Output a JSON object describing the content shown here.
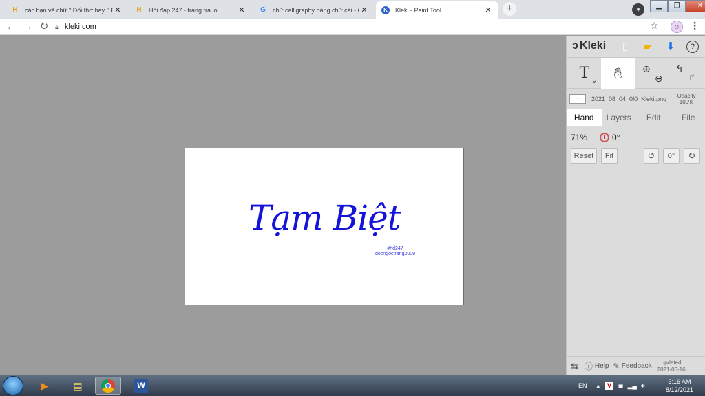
{
  "browser": {
    "tabs": [
      {
        "title": "các bạn vẽ chữ \" Đối thơ hay \" Bằ",
        "favicon": "H"
      },
      {
        "title": "Hỏi đáp 247 - trang tra loi",
        "favicon": "H"
      },
      {
        "title": "chữ calligraphy bảng chữ cái - Go",
        "favicon": "G"
      },
      {
        "title": "Kleki - Paint Tool",
        "favicon": "K"
      }
    ],
    "new_tab": "+",
    "url": "kleki.com"
  },
  "canvas": {
    "text": "Tạm Biệt",
    "credit_line1": "#hd247",
    "credit_line2": "docngoctrang2009"
  },
  "panel": {
    "logo": "Kleki",
    "file_name": "2021_08_04_0l0_Kleki.png",
    "opacity_label": "Opacity",
    "opacity_value": "100%",
    "tabs": [
      "Hand",
      "Layers",
      "Edit",
      "File"
    ],
    "zoom": "71%",
    "rotation": "0°",
    "reset_label": "Reset",
    "fit_label": "Fit",
    "rotate_value": "0°",
    "help_label": "Help",
    "feedback_label": "Feedback",
    "updated_label": "updated",
    "updated_date": "2021-06-16"
  },
  "taskbar": {
    "language": "EN",
    "time": "3:16 AM",
    "date": "8/12/2021"
  },
  "colors": {
    "script": "#1414d8",
    "canvas_bg": "#9c9c9c",
    "panel_bg": "#dcdcdc"
  }
}
